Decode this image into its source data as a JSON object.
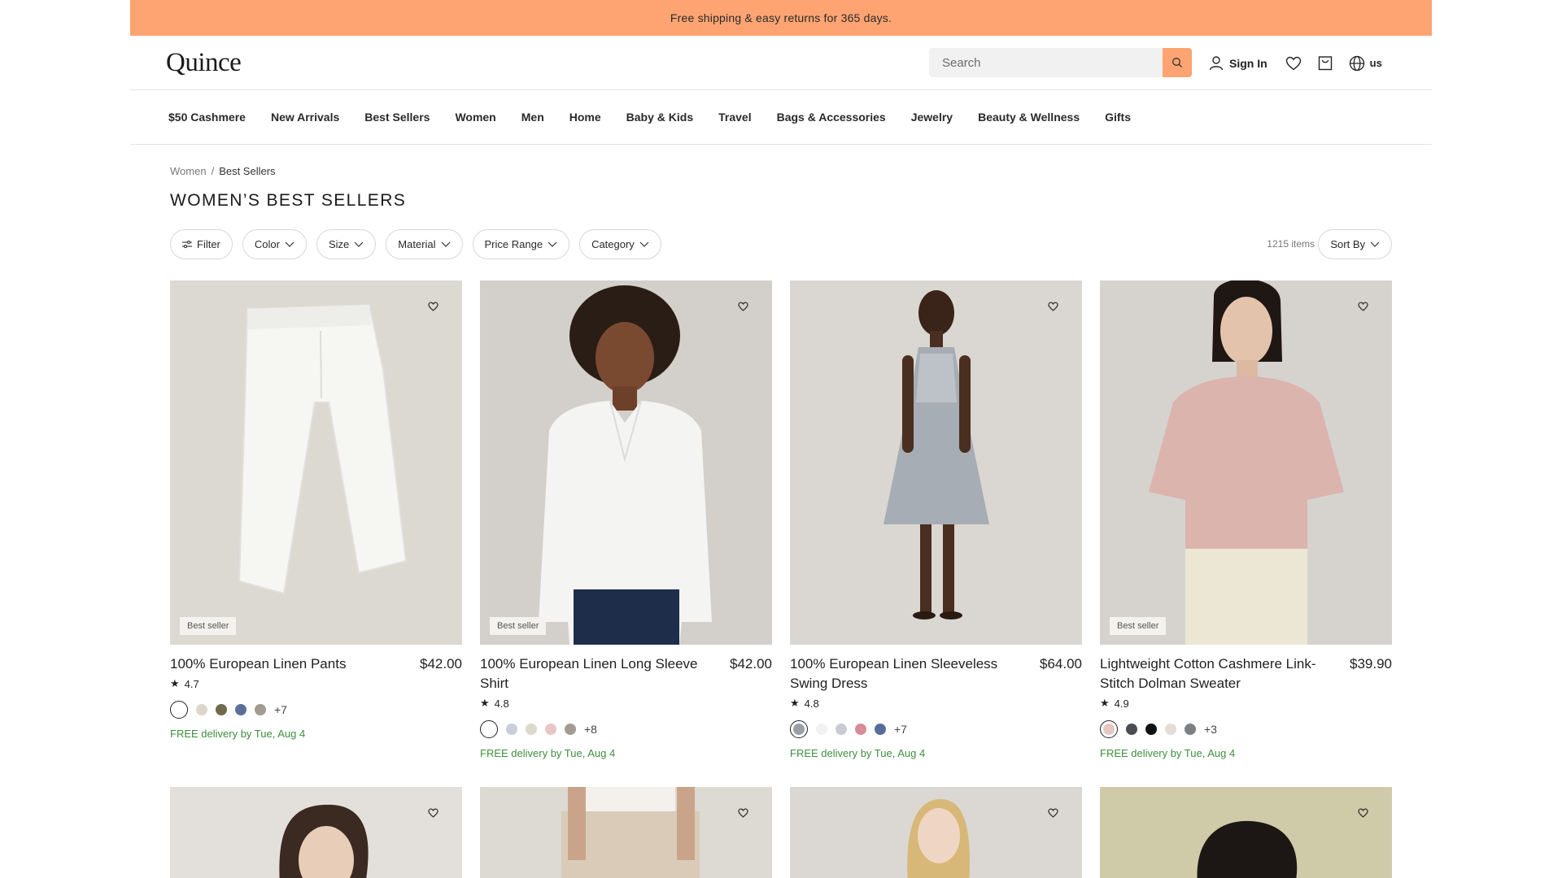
{
  "promo": {
    "text": "Free shipping & easy returns for 365 days."
  },
  "header": {
    "logo": "Quince",
    "search_placeholder": "Search",
    "sign_in": "Sign In",
    "region": "us"
  },
  "nav": [
    "$50 Cashmere",
    "New Arrivals",
    "Best Sellers",
    "Women",
    "Men",
    "Home",
    "Baby & Kids",
    "Travel",
    "Bags & Accessories",
    "Jewelry",
    "Beauty & Wellness",
    "Gifts"
  ],
  "breadcrumb": {
    "parent": "Women",
    "sep": "/",
    "current": "Best Sellers"
  },
  "page_title": "WOMEN’S BEST SELLERS",
  "filters": {
    "filter": "Filter",
    "color": "Color",
    "size": "Size",
    "material": "Material",
    "price_range": "Price Range",
    "category": "Category",
    "items_count": "1215 items",
    "sort": "Sort By"
  },
  "products": [
    {
      "name": "100% European Linen Pants",
      "price": "$42.00",
      "rating": "4.7",
      "badge": "Best seller",
      "more": "+7",
      "delivery": "FREE delivery by Tue, Aug 4",
      "swatches": [
        "#ffffff",
        "#ddd6cc",
        "#6f6a4d",
        "#5b6f99",
        "#a39a90"
      ],
      "bg": "#dcd8d2"
    },
    {
      "name": "100% European Linen Long Sleeve Shirt",
      "price": "$42.00",
      "rating": "4.8",
      "badge": "Best seller",
      "more": "+8",
      "delivery": "FREE delivery by Tue, Aug 4",
      "swatches": [
        "#ffffff",
        "#c9ced8",
        "#ddd8cc",
        "#e9c5c8",
        "#a29c95"
      ],
      "bg": "#d3d0cb"
    },
    {
      "name": "100% European Linen Sleeveless Swing Dress",
      "price": "$64.00",
      "rating": "4.8",
      "badge": "",
      "more": "+7",
      "delivery": "FREE delivery by Tue, Aug 4",
      "swatches": [
        "#9aa0a6",
        "#f2f2f2",
        "#c8ccd2",
        "#d98c95",
        "#566d9c"
      ],
      "bg": "#dad7d2"
    },
    {
      "name": "Lightweight Cotton Cashmere Link-Stitch Dolman Sweater",
      "price": "$39.90",
      "rating": "4.9",
      "badge": "Best seller",
      "more": "+3",
      "delivery": "FREE delivery by Tue, Aug 4",
      "swatches": [
        "#e8c7c3",
        "#4b4d52",
        "#111111",
        "#e5dcd6",
        "#7d7f82"
      ],
      "bg": "#d6d3cf"
    }
  ],
  "row2_bgs": [
    "#e3e0db",
    "#ddd9d3",
    "#dbd8d3",
    "#cfcaa8"
  ]
}
